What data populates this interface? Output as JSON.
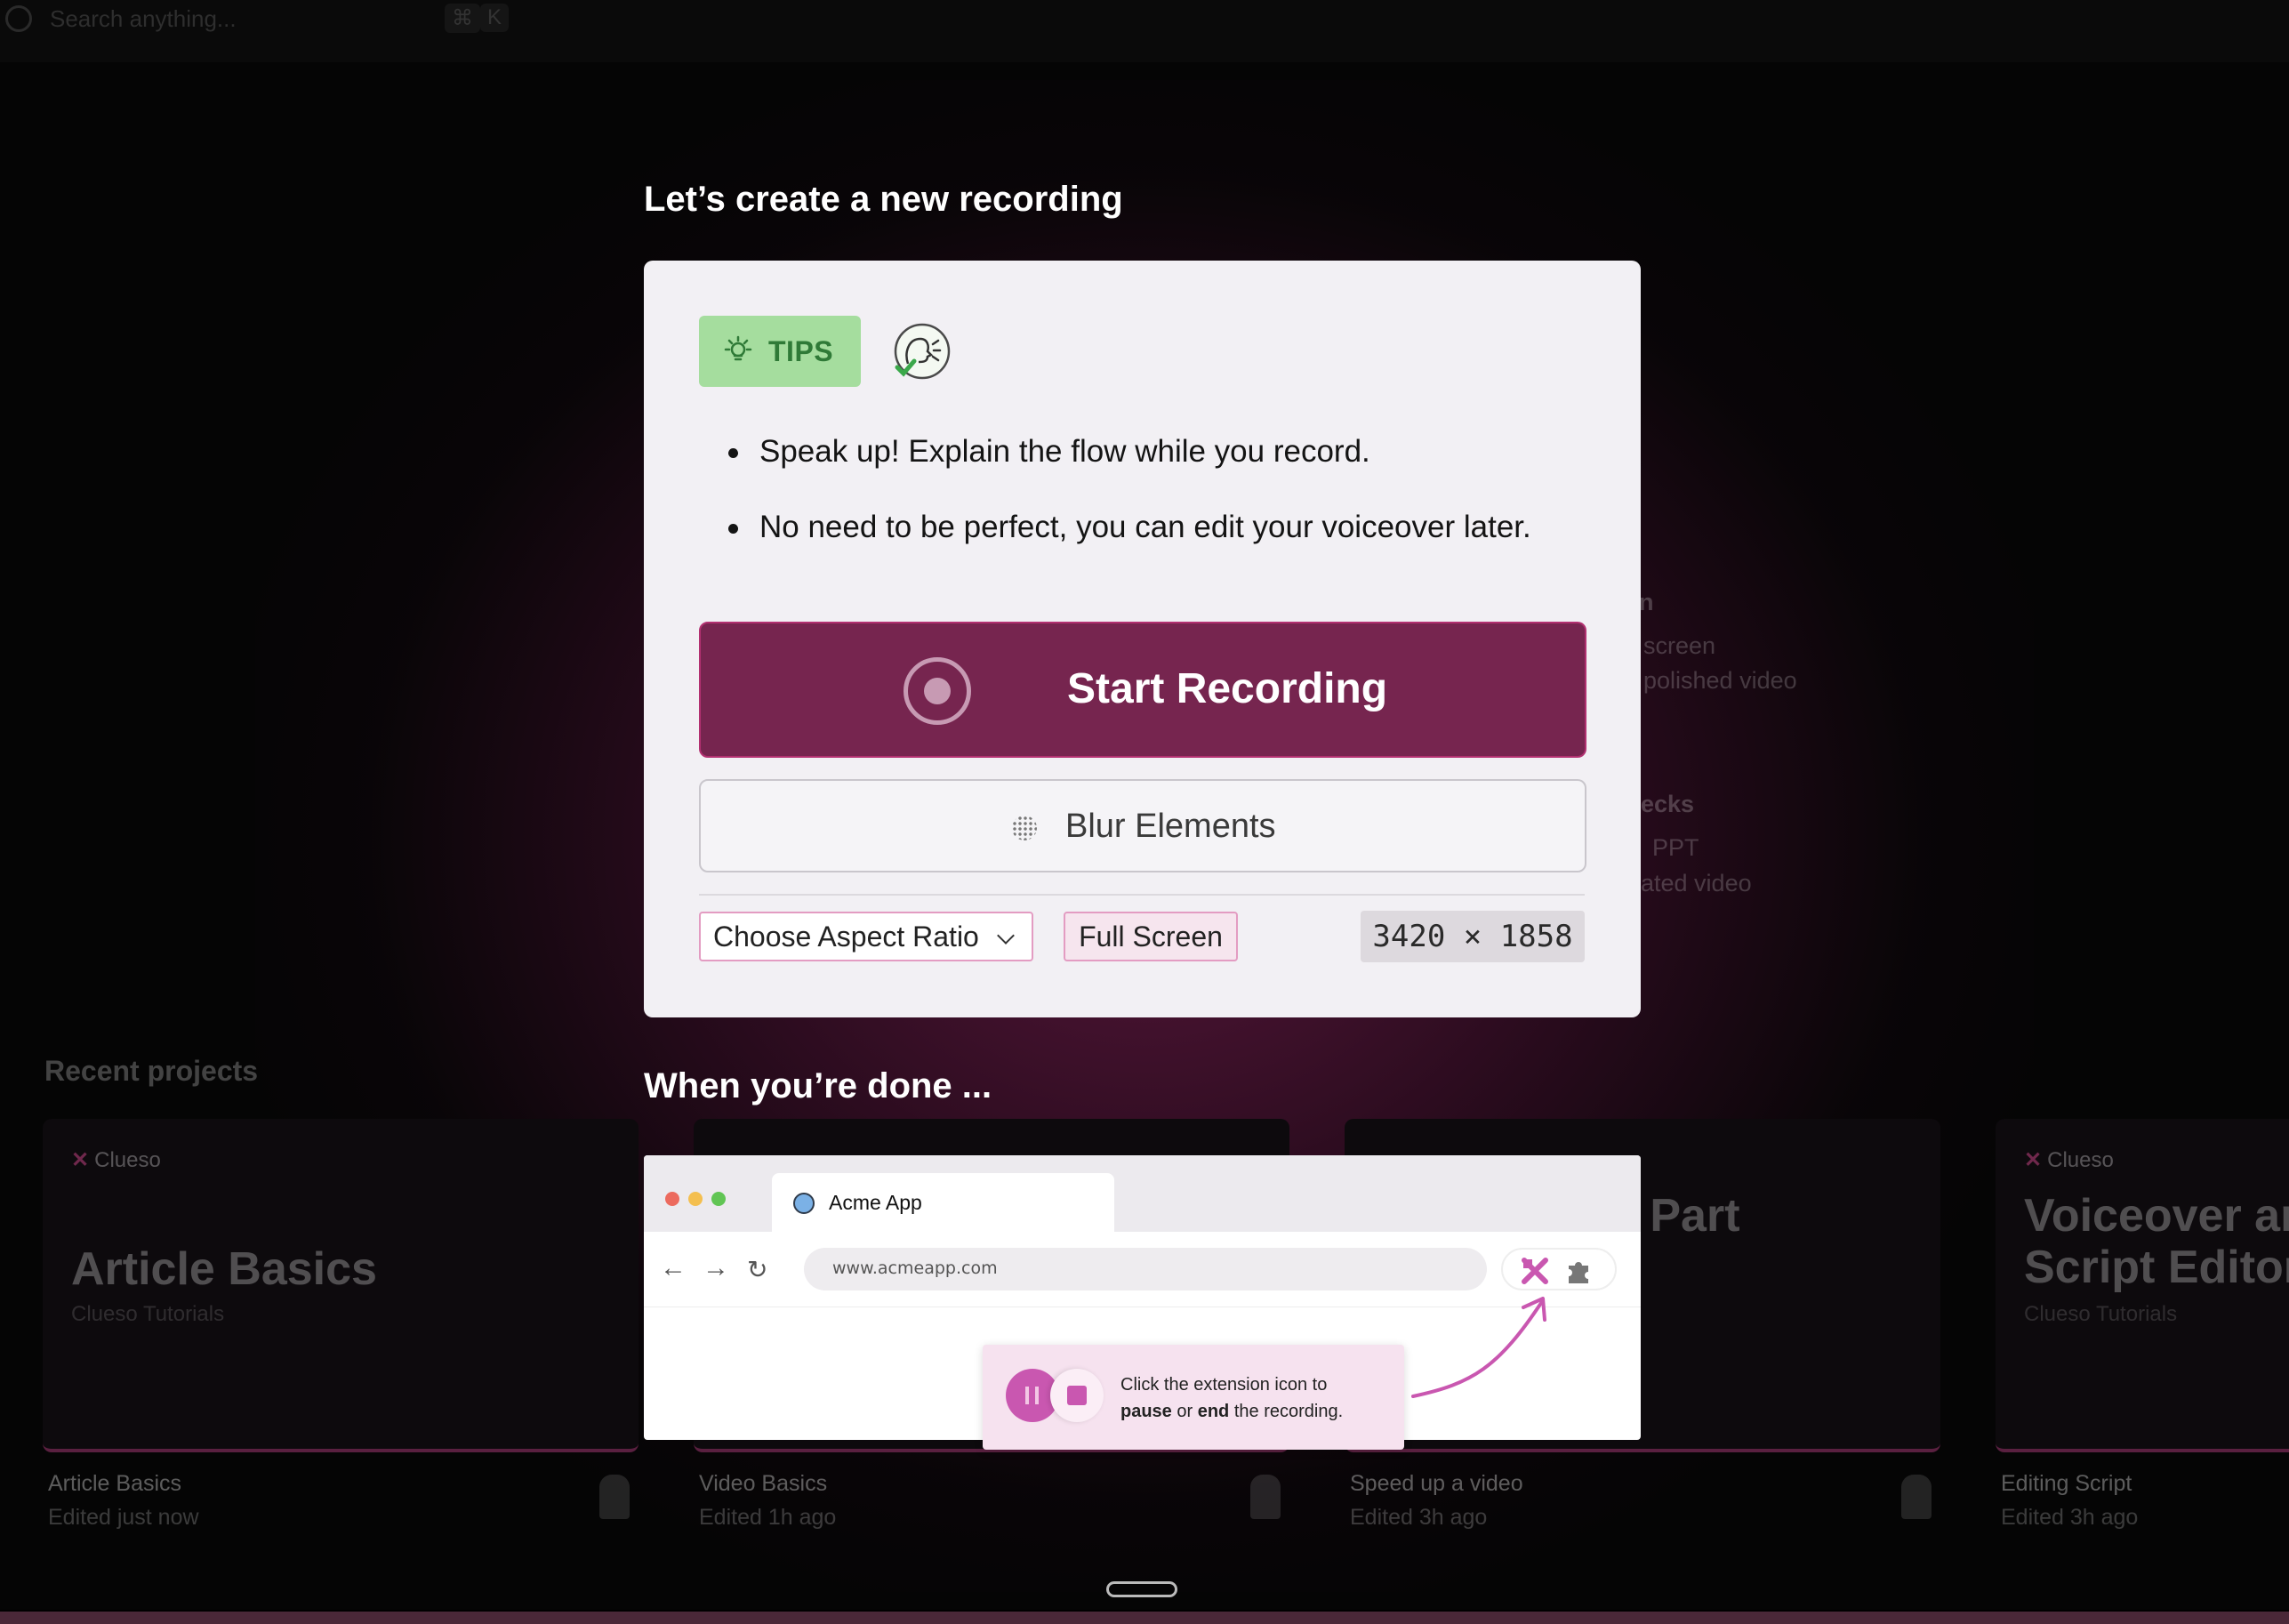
{
  "search": {
    "placeholder": "Search anything...",
    "shortcut_cmd": "⌘",
    "shortcut_key": "K"
  },
  "background": {
    "side_fragments": [
      "n",
      "screen",
      "polished video",
      "ecks",
      "PPT",
      "ated video"
    ],
    "recent_title": "Recent projects",
    "projects": [
      {
        "brand": "Clueso",
        "thumb_title": "Article Basics",
        "thumb_sub": "Clueso Tutorials",
        "name": "Article Basics",
        "edited": "Edited just now"
      },
      {
        "brand": "",
        "thumb_title": "",
        "thumb_sub": "",
        "name": "Video Basics",
        "edited": "Edited 1h ago"
      },
      {
        "brand": "",
        "thumb_title": "a Part\no",
        "thumb_sub": "",
        "name": "Speed up a video",
        "edited": "Edited 3h ago"
      },
      {
        "brand": "Clueso",
        "thumb_title": "Voiceover an\nScript Editor",
        "thumb_sub": "Clueso Tutorials",
        "name": "Editing Script",
        "edited": "Edited 3h ago"
      }
    ]
  },
  "modal": {
    "heading": "Let’s create a new recording",
    "tips_label": "TIPS",
    "tips": [
      "Speak up! Explain the flow while you record.",
      "No need to be perfect, you can edit your voiceover later."
    ],
    "start_label": "Start Recording",
    "blur_label": "Blur Elements",
    "aspect_label": "Choose Aspect Ratio",
    "fullscreen_label": "Full Screen",
    "resolution": "3420 × 1858",
    "done_heading": "When you’re done ..."
  },
  "illustration": {
    "tab_title": "Acme App",
    "url": "www.acmeapp.com",
    "callout_line1": "Click the extension icon to",
    "callout_pause": "pause",
    "callout_or": " or ",
    "callout_end": "end",
    "callout_tail": " the recording."
  },
  "colors": {
    "accent": "#76254f",
    "accent_border": "#b23070",
    "tips_bg": "#a5dd9e",
    "tips_text": "#2f7a37",
    "extension": "#c957b0"
  }
}
